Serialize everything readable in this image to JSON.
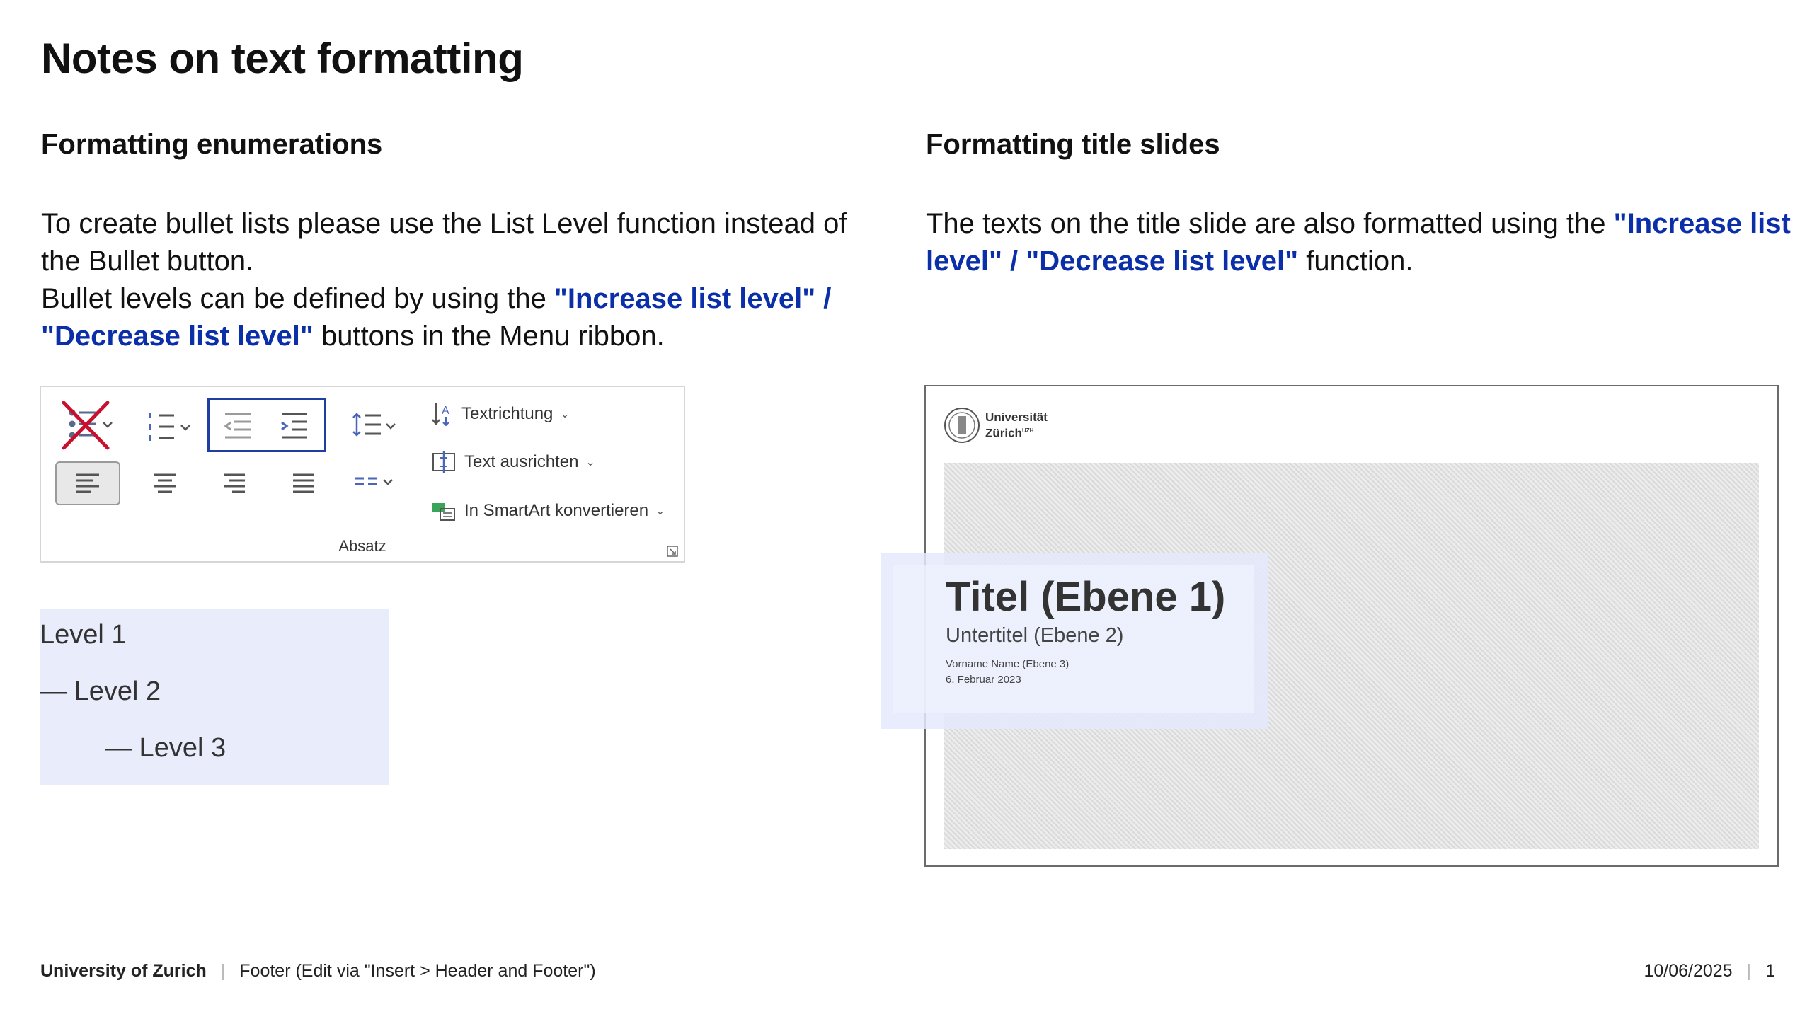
{
  "slide": {
    "title": "Notes on text formatting",
    "left": {
      "heading": "Formatting enumerations",
      "p1": "To create bullet lists please use the List Level function instead of the Bullet button.",
      "p2_pre": "Bullet levels can be defined by using the ",
      "p2_hl": "\"Increase list level\" / \"Decrease list level\"",
      "p2_post": " buttons in the Menu ribbon."
    },
    "right": {
      "heading": "Formatting title slides",
      "p_pre": "The texts on the title slide are also formatted using the ",
      "p_hl": "\"Increase list level\" / \"Decrease list level\"",
      "p_post": " function."
    }
  },
  "ribbon": {
    "text_direction": "Textrichtung",
    "align_text": "Text ausrichten",
    "smartart": "In SmartArt konvertieren",
    "group_label": "Absatz",
    "highlight_color": "#1f3fa0",
    "cross_color": "#c8102e"
  },
  "levels": {
    "level1": "Level 1",
    "level2": "— Level 2",
    "level3": "— Level 3"
  },
  "preview": {
    "logo_line1": "Universität",
    "logo_line2": "Zürich",
    "logo_superscript": "UZH",
    "title": "Titel (Ebene 1)",
    "subtitle": "Untertitel (Ebene 2)",
    "name": "Vorname Name (Ebene 3)",
    "date": "6. Februar 2023"
  },
  "footer": {
    "org": "University of Zurich",
    "text": "Footer (Edit via \"Insert > Header and Footer\")",
    "date": "10/06/2025",
    "page": "1"
  }
}
